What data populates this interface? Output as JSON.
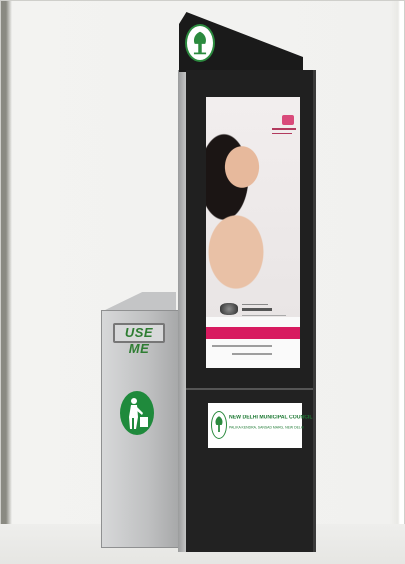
{
  "bin": {
    "label": "USE ME",
    "icon": "person-throwing-trash-icon"
  },
  "kiosk": {
    "top_logo_icon": "tree-emblem-icon"
  },
  "ad": {
    "brand_icon": "jewellery-brand-icon"
  },
  "ndmc_sign": {
    "name": "NEW DELHI MUNICIPAL COUNCIL",
    "sub": "PALIKA KENDRA, SANSAD MARG, NEW DELHI",
    "logo_icon": "tree-emblem-icon"
  },
  "colors": {
    "green": "#1f8a3c",
    "panel": "#1a1a1a",
    "pink": "#d81b60",
    "bin_grey": "#c4c5c6"
  }
}
